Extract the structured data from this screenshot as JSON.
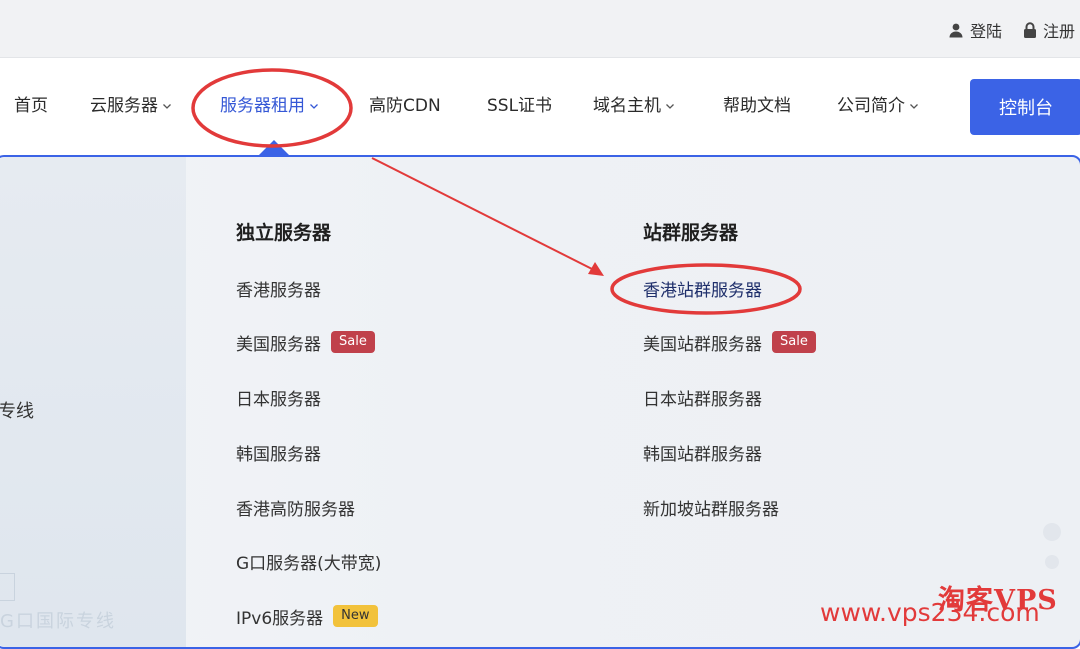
{
  "topbar": {
    "login_label": "登陆",
    "register_label": "注册"
  },
  "nav": {
    "items": [
      {
        "label": "首页",
        "has_dropdown": false
      },
      {
        "label": "云服务器",
        "has_dropdown": true
      },
      {
        "label": "服务器租用",
        "has_dropdown": true,
        "active": true
      },
      {
        "label": "高防CDN",
        "has_dropdown": false
      },
      {
        "label": "SSL证书",
        "has_dropdown": false
      },
      {
        "label": "域名主机",
        "has_dropdown": true
      },
      {
        "label": "帮助文档",
        "has_dropdown": false
      },
      {
        "label": "公司简介",
        "has_dropdown": true
      }
    ],
    "console_label": "控制台"
  },
  "dropdown": {
    "side_text": "专线",
    "faint_text": "G口国际专线",
    "columns": [
      {
        "title": "独立服务器",
        "links": [
          {
            "label": "香港服务器"
          },
          {
            "label": "美国服务器",
            "badge": "Sale"
          },
          {
            "label": "日本服务器"
          },
          {
            "label": "韩国服务器"
          },
          {
            "label": "香港高防服务器"
          },
          {
            "label": "G口服务器(大带宽)"
          },
          {
            "label": "IPv6服务器",
            "badge": "New"
          }
        ]
      },
      {
        "title": "站群服务器",
        "links": [
          {
            "label": "香港站群服务器",
            "highlighted": true
          },
          {
            "label": "美国站群服务器",
            "badge": "Sale"
          },
          {
            "label": "日本站群服务器"
          },
          {
            "label": "韩国站群服务器"
          },
          {
            "label": "新加坡站群服务器"
          }
        ]
      }
    ]
  },
  "watermark": {
    "brand": "淘客VPS",
    "url": "www.vps234.com"
  },
  "colors": {
    "accent": "#3b63e6",
    "annotation_red": "#e23a3a",
    "sale_badge": "#c0414b",
    "new_badge": "#f2c23b"
  }
}
